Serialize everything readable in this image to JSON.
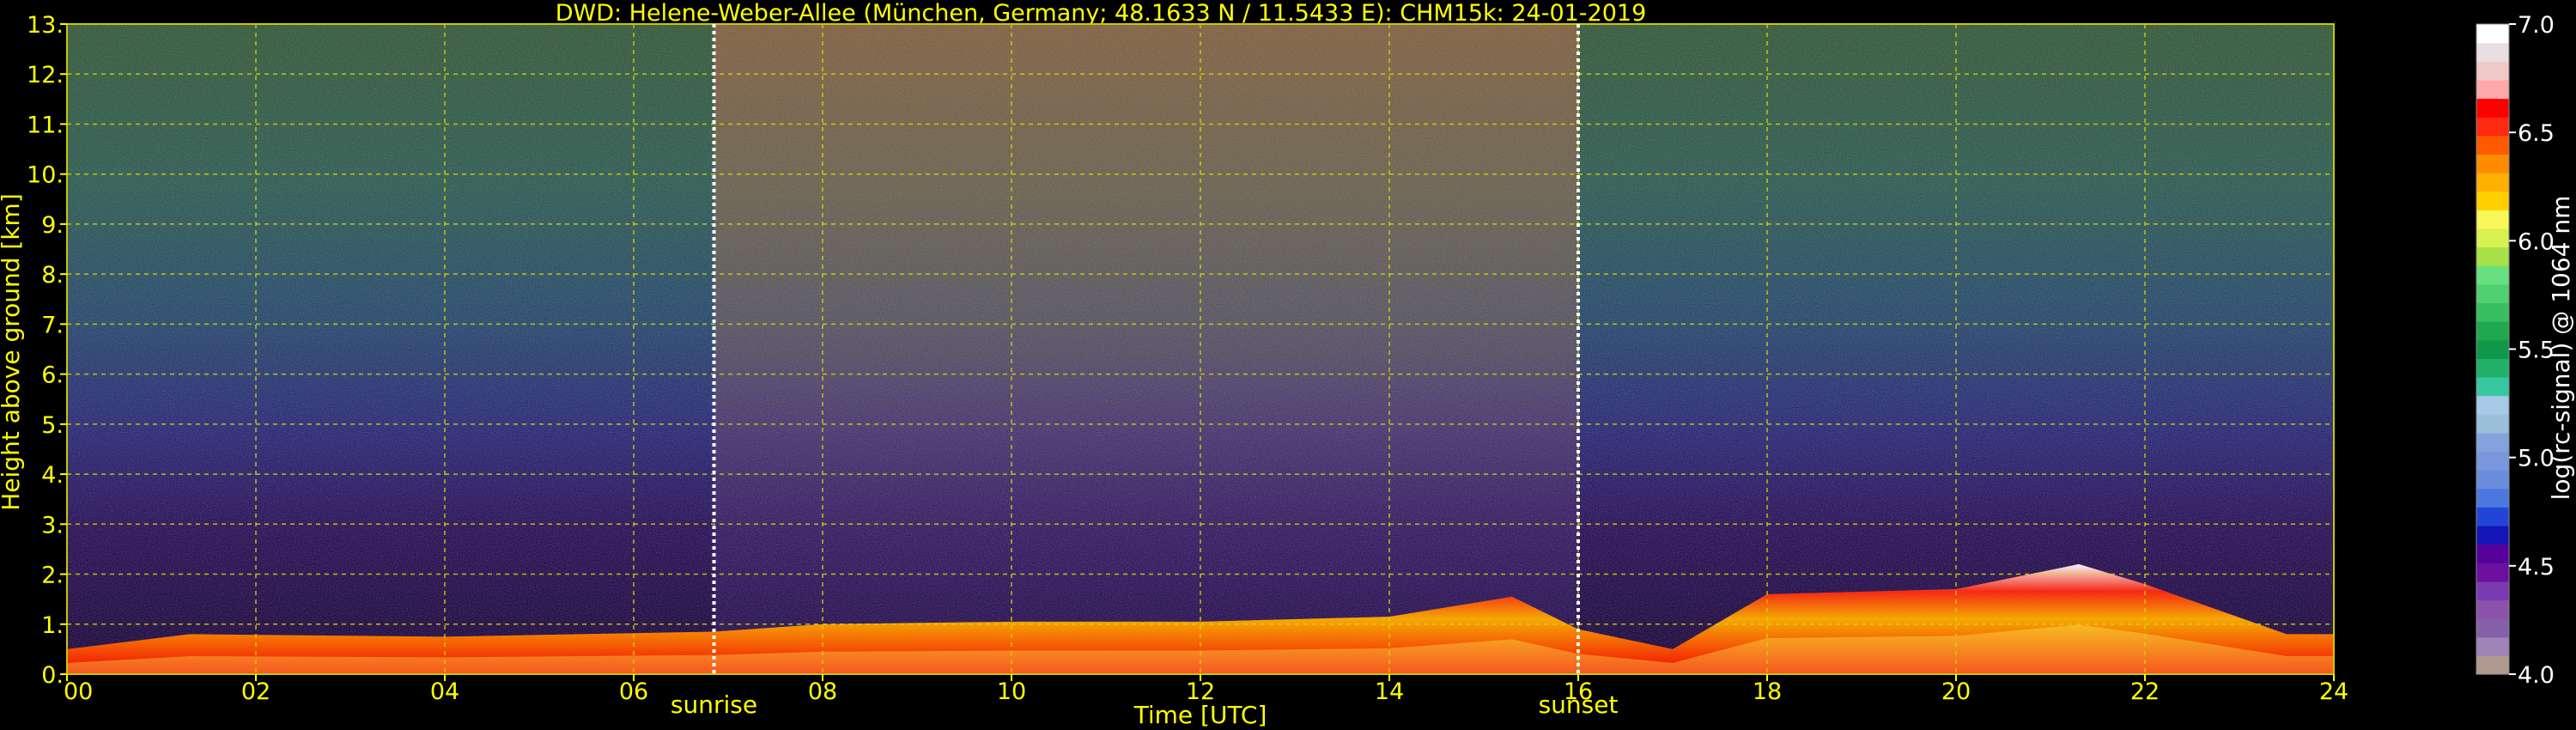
{
  "chart_data": {
    "type": "heatmap",
    "title": "DWD: Helene-Weber-Allee (München, Germany; 48.1633 N / 11.5433 E):    CHM15k: 24-01-2019",
    "xlabel": "Time [UTC]",
    "ylabel": "Height above ground [km]",
    "xlim": [
      0,
      24
    ],
    "ylim": [
      0,
      13
    ],
    "x_ticks": [
      0,
      2,
      4,
      6,
      8,
      10,
      12,
      14,
      16,
      18,
      20,
      22,
      24
    ],
    "x_tick_labels": [
      "00",
      "02",
      "04",
      "06",
      "08",
      "10",
      "12",
      "14",
      "16",
      "18",
      "20",
      "22",
      "24"
    ],
    "y_ticks": [
      0,
      1,
      2,
      3,
      4,
      5,
      6,
      7,
      8,
      9,
      10,
      11,
      12,
      13
    ],
    "y_tick_labels": [
      "0.",
      "1.",
      "2.",
      "3.",
      "4.",
      "5.",
      "6.",
      "7.",
      "8.",
      "9.",
      "10.",
      "11.",
      "12.",
      "13."
    ],
    "grid": true,
    "markers": [
      {
        "label": "sunrise",
        "x": 6.85
      },
      {
        "label": "sunset",
        "x": 16.0
      }
    ],
    "colorbar": {
      "label": "log(rc-signal) @ 1064 nm",
      "min": 4.0,
      "max": 7.0,
      "ticks": [
        4.0,
        4.5,
        5.0,
        5.5,
        6.0,
        6.5,
        7.0
      ],
      "tick_labels": [
        "4.0",
        "4.5",
        "5.0",
        "5.5",
        "6.0",
        "6.5",
        "7.0"
      ],
      "colors": [
        "#b09a90",
        "#9e85b8",
        "#8560a8",
        "#8a52a8",
        "#7a3ab0",
        "#6a0fa0",
        "#55009a",
        "#1515b8",
        "#2245d8",
        "#4a78e0",
        "#6a8cdc",
        "#7a96dc",
        "#86a2dc",
        "#9ac0dc",
        "#a8c8e8",
        "#38c8a0",
        "#20b068",
        "#109848",
        "#20a850",
        "#38c060",
        "#50d070",
        "#68e080",
        "#a8e048",
        "#d8f050",
        "#f8f858",
        "#ffd000",
        "#ffb000",
        "#ff8c00",
        "#ff5a00",
        "#ff2a10",
        "#ff0000",
        "#ffa8a8",
        "#f0c8c8",
        "#e8e0e0",
        "#ffffff"
      ]
    },
    "boundary_layer": {
      "x": [
        0,
        1.3,
        4,
        6.85,
        8,
        10,
        12,
        14,
        15.3,
        16,
        17,
        18,
        20,
        21.3,
        22,
        23.5,
        24
      ],
      "top": [
        0.5,
        0.8,
        0.75,
        0.85,
        1.0,
        1.05,
        1.05,
        1.15,
        1.55,
        0.9,
        0.5,
        1.6,
        1.7,
        2.2,
        1.8,
        0.8,
        0.8
      ]
    }
  }
}
